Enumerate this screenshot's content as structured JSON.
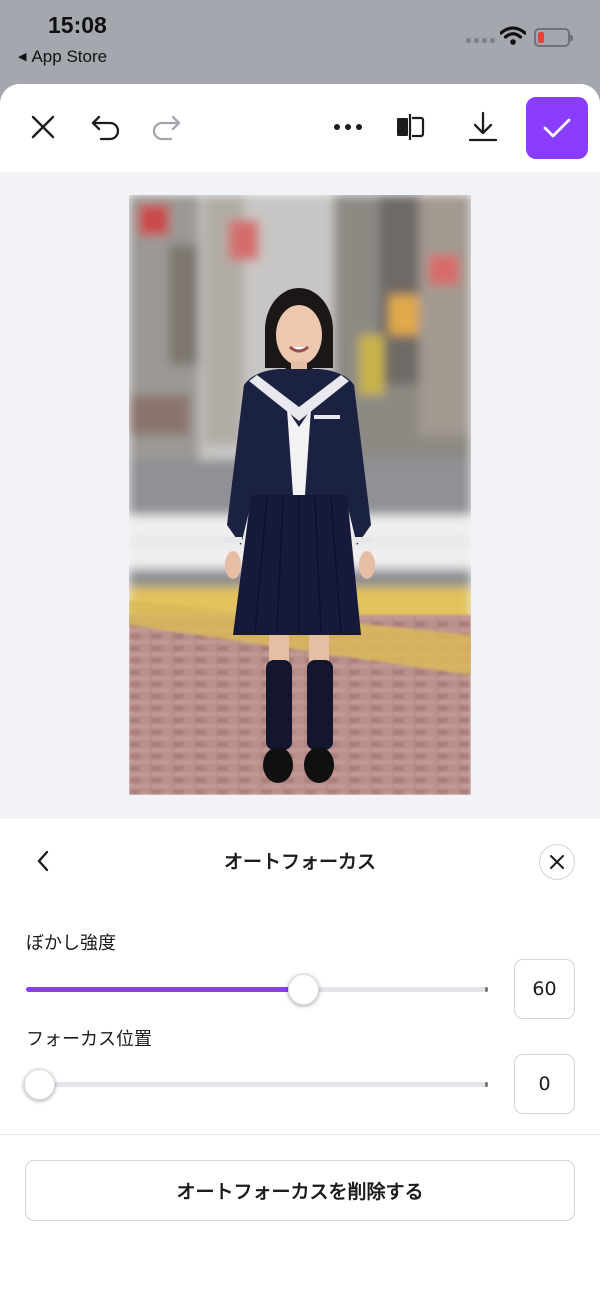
{
  "status_bar": {
    "time": "15:08",
    "back_app": "App Store",
    "battery_color": "#e8413a"
  },
  "toolbar": {
    "icons": [
      "close-icon",
      "undo-icon",
      "redo-icon",
      "more-icon",
      "compare-icon",
      "download-icon",
      "check-icon"
    ],
    "accent_color": "#8b3dff"
  },
  "photo": {
    "subject": "photo"
  },
  "panel": {
    "title": "オートフォーカス",
    "blur": {
      "label": "ぼかし強度",
      "value": "60",
      "fraction": 0.6
    },
    "focus": {
      "label": "フォーカス位置",
      "value": "0",
      "fraction": 0.0
    },
    "remove_label": "オートフォーカスを削除する"
  }
}
